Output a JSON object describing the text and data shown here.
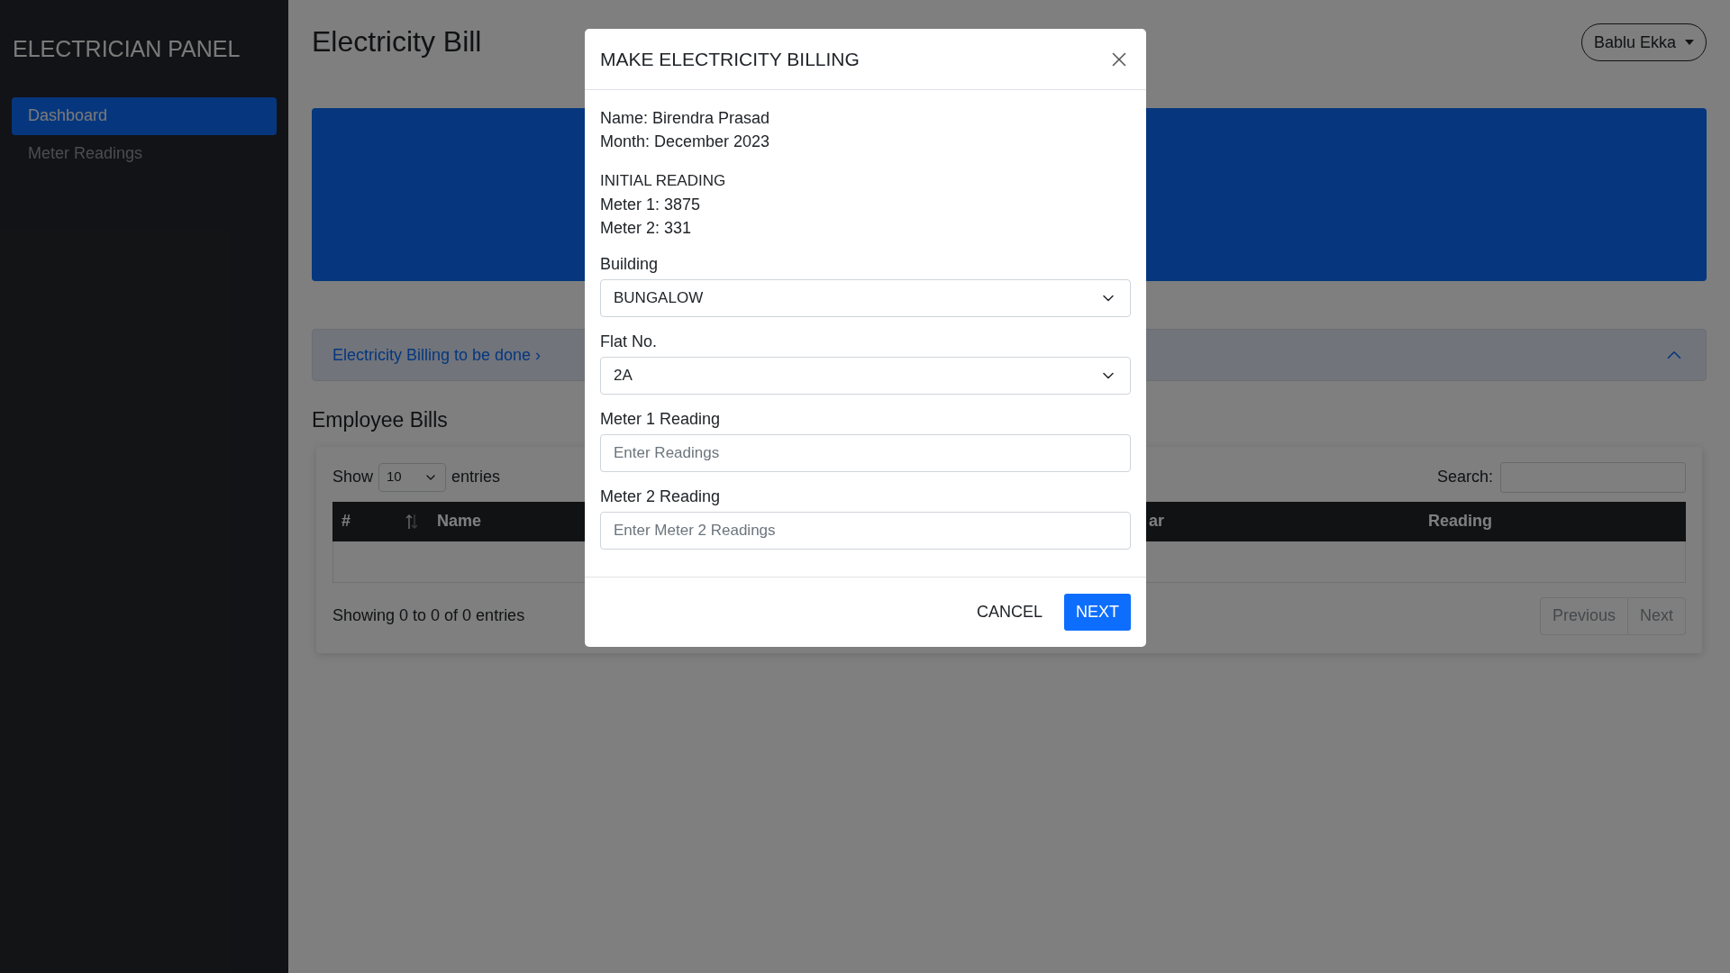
{
  "sidebar": {
    "title": "ELECTRICIAN PANEL",
    "items": [
      {
        "label": "Dashboard",
        "selected": true
      },
      {
        "label": "Meter Readings",
        "selected": false
      }
    ]
  },
  "header": {
    "title": "Electricity Bill",
    "user_menu": "Bablu Ekka"
  },
  "alert": {
    "link": "Electricity Billing to be done ›",
    "expanded": true
  },
  "section_title": "Employee Bills",
  "table": {
    "show_label": "Show",
    "page_size": "10",
    "entries_label": "entries",
    "search_label": "Search:",
    "columns": [
      {
        "label": "#",
        "sortable": true
      },
      {
        "label": "Name"
      },
      {
        "label": "ar"
      },
      {
        "label": "Reading"
      }
    ],
    "info": "Showing 0 to 0 of 0 entries",
    "pagination": [
      {
        "label": "Previous",
        "disabled": true
      },
      {
        "label": "Next",
        "disabled": true
      }
    ]
  },
  "modal": {
    "title": "MAKE ELECTRICITY BILLING",
    "name_line": "Name: Birendra Prasad",
    "month_line": "Month: December 2023",
    "reading_heading": "INITIAL READING",
    "reading_lines": [
      "Meter 1: 3875",
      "Meter 2: 331"
    ],
    "fields": [
      {
        "kind": "select",
        "label": "Building",
        "value": "BUNGALOW"
      },
      {
        "kind": "select",
        "label": "Flat No.",
        "value": "2A"
      },
      {
        "kind": "input",
        "label": "Meter 1 Reading",
        "placeholder": "Enter Readings"
      },
      {
        "kind": "input",
        "label": "Meter 2 Reading",
        "placeholder": "Enter Meter 2 Readings"
      }
    ],
    "cancel": "CANCEL",
    "next": "NEXT"
  }
}
